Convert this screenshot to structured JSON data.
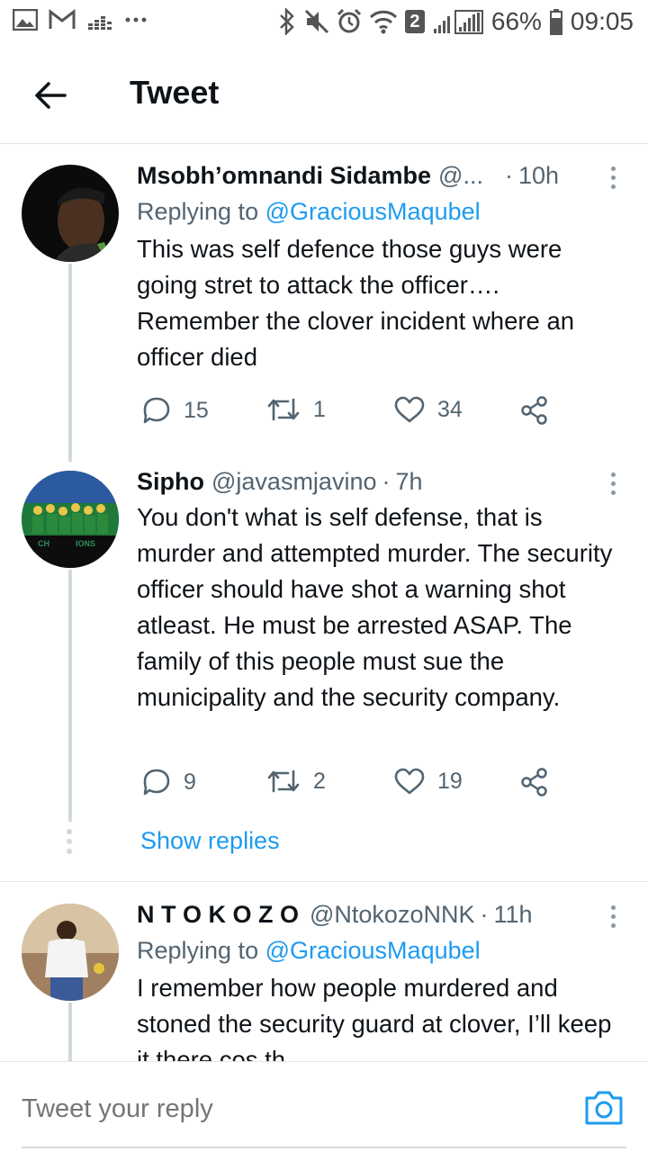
{
  "status_bar": {
    "battery_text": "66%",
    "time": "09:05",
    "sim_badge": "2",
    "left_icons": [
      "gallery-icon",
      "gmail-icon",
      "equalizer-icon",
      "more-notifications-icon"
    ],
    "right_icons": [
      "bluetooth-icon",
      "mute-icon",
      "alarm-icon",
      "wifi-icon",
      "signal-icon",
      "battery-icon"
    ]
  },
  "header": {
    "title": "Tweet",
    "back_icon": "arrow-left-icon"
  },
  "tweets": [
    {
      "name": "Msobh’omnandi Sidambe",
      "handle": "@...",
      "time": "10h",
      "replying_label": "Replying to",
      "replying_to": "@GraciousMaqubel",
      "text": "This was self defence those guys were going stret to attack the officer…. Remember the clover incident where an officer died",
      "replies": "15",
      "retweets": "1",
      "likes": "34"
    },
    {
      "name": "Sipho",
      "handle": "@javasmjavino",
      "time": "7h",
      "text": "You don't what is self defense, that is murder and attempted murder. The security officer should have shot a warning shot atleast. He must be arrested ASAP. The family of this people must sue the municipality and the security company.",
      "replies": "9",
      "retweets": "2",
      "likes": "19",
      "show_replies": "Show replies"
    },
    {
      "name": "N T O K O Z O",
      "handle": "@NtokozoNNK",
      "time": "11h",
      "replying_label": "Replying to",
      "replying_to": "@GraciousMaqubel",
      "text": "I remember how people murdered and stoned the security guard at clover, I’ll keep it there cos th"
    }
  ],
  "compose": {
    "placeholder": "Tweet your reply",
    "camera_icon": "camera-icon"
  },
  "colors": {
    "accent": "#1d9bf0",
    "secondary_text": "#536471",
    "thread_line": "#cfd9de"
  }
}
